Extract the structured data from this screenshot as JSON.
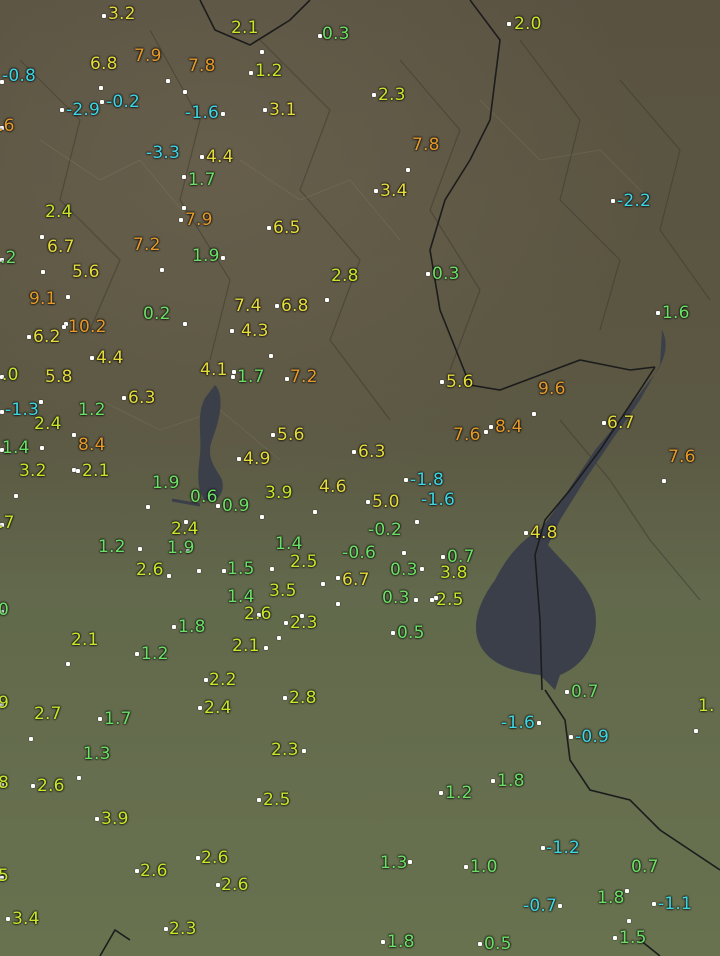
{
  "colors": {
    "cold": "#3dd6e6",
    "cool": "#6be066",
    "mild": "#c9e62a",
    "warm": "#e6dc3c",
    "hot": "#e69a2a",
    "lake": "#3b3f4a",
    "plain": "#66714f",
    "mountain": "#57513f"
  },
  "readings": [
    {
      "id": "s1",
      "value": "3.2",
      "tier": "warm"
    },
    {
      "id": "s2",
      "value": "2.1",
      "tier": "mild"
    },
    {
      "id": "s3",
      "value": "0.3",
      "tier": "cool"
    },
    {
      "id": "s4",
      "value": "2.0",
      "tier": "mild"
    },
    {
      "id": "s5",
      "value": "-0.8",
      "tier": "cold"
    },
    {
      "id": "s6",
      "value": "6.8",
      "tier": "warm"
    },
    {
      "id": "s7",
      "value": "7.9",
      "tier": "hot"
    },
    {
      "id": "s8",
      "value": "7.8",
      "tier": "hot"
    },
    {
      "id": "s9",
      "value": "1.2",
      "tier": "mild"
    },
    {
      "id": "s10",
      "value": ".6",
      "tier": "hot"
    },
    {
      "id": "s11",
      "value": "-2.9",
      "tier": "cold"
    },
    {
      "id": "s12",
      "value": "-0.2",
      "tier": "cold"
    },
    {
      "id": "s13",
      "value": "-1.6",
      "tier": "cold"
    },
    {
      "id": "s14",
      "value": "3.1",
      "tier": "warm"
    },
    {
      "id": "s15",
      "value": "2.3",
      "tier": "mild"
    },
    {
      "id": "s16",
      "value": "-3.3",
      "tier": "cold"
    },
    {
      "id": "s17",
      "value": "4.4",
      "tier": "warm"
    },
    {
      "id": "s18",
      "value": "7.8",
      "tier": "hot"
    },
    {
      "id": "s19",
      "value": "1.7",
      "tier": "cool"
    },
    {
      "id": "s20",
      "value": "3.4",
      "tier": "warm"
    },
    {
      "id": "s21",
      "value": "-2.2",
      "tier": "cold"
    },
    {
      "id": "s22",
      "value": "2.4",
      "tier": "mild"
    },
    {
      "id": "s23",
      "value": "7.9",
      "tier": "hot"
    },
    {
      "id": "s24",
      "value": "6.5",
      "tier": "warm"
    },
    {
      "id": "s25",
      "value": "6.7",
      "tier": "warm"
    },
    {
      "id": "s26",
      "value": "7.2",
      "tier": "hot"
    },
    {
      "id": "s27",
      "value": "1.9",
      "tier": "cool"
    },
    {
      "id": "s28",
      "value": ".2",
      "tier": "cool"
    },
    {
      "id": "s29",
      "value": "5.6",
      "tier": "warm"
    },
    {
      "id": "s30",
      "value": "0.3",
      "tier": "cool"
    },
    {
      "id": "s31",
      "value": "2.8",
      "tier": "mild"
    },
    {
      "id": "s32",
      "value": "9.1",
      "tier": "hot"
    },
    {
      "id": "s33",
      "value": "0.2",
      "tier": "cool"
    },
    {
      "id": "s34",
      "value": "7.4",
      "tier": "warm"
    },
    {
      "id": "s35",
      "value": "6.8",
      "tier": "warm"
    },
    {
      "id": "s36",
      "value": "1.6",
      "tier": "cool"
    },
    {
      "id": "s37",
      "value": "10.2",
      "tier": "hot"
    },
    {
      "id": "s38",
      "value": "6.2",
      "tier": "warm"
    },
    {
      "id": "s39",
      "value": "4.3",
      "tier": "warm"
    },
    {
      "id": "s40",
      "value": "4.4",
      "tier": "warm"
    },
    {
      "id": "s41",
      "value": ".0",
      "tier": "mild"
    },
    {
      "id": "s42",
      "value": "5.8",
      "tier": "warm"
    },
    {
      "id": "s43",
      "value": "4.1",
      "tier": "warm"
    },
    {
      "id": "s44",
      "value": "1.7",
      "tier": "cool"
    },
    {
      "id": "s45",
      "value": "7.2",
      "tier": "hot"
    },
    {
      "id": "s46",
      "value": "5.6",
      "tier": "warm"
    },
    {
      "id": "s47",
      "value": "9.6",
      "tier": "hot"
    },
    {
      "id": "s48",
      "value": "-1.3",
      "tier": "cold"
    },
    {
      "id": "s49",
      "value": "1.2",
      "tier": "cool"
    },
    {
      "id": "s50",
      "value": "6.3",
      "tier": "warm"
    },
    {
      "id": "s51",
      "value": "2.4",
      "tier": "mild"
    },
    {
      "id": "s52",
      "value": "6.7",
      "tier": "warm"
    },
    {
      "id": "s53",
      "value": "8.4",
      "tier": "hot"
    },
    {
      "id": "s54",
      "value": "7.6",
      "tier": "hot"
    },
    {
      "id": "s55",
      "value": "8.4",
      "tier": "hot"
    },
    {
      "id": "s56",
      "value": "5.6",
      "tier": "warm"
    },
    {
      "id": "s57",
      "value": "1.4",
      "tier": "cool"
    },
    {
      "id": "s58",
      "value": "6.3",
      "tier": "warm"
    },
    {
      "id": "s59",
      "value": "4.9",
      "tier": "warm"
    },
    {
      "id": "s60",
      "value": "7.6",
      "tier": "hot"
    },
    {
      "id": "s61",
      "value": "3.2",
      "tier": "mild"
    },
    {
      "id": "s62",
      "value": "2.1",
      "tier": "mild"
    },
    {
      "id": "s63",
      "value": "-1.8",
      "tier": "cold"
    },
    {
      "id": "s64",
      "value": "1.9",
      "tier": "cool"
    },
    {
      "id": "s65",
      "value": "4.6",
      "tier": "warm"
    },
    {
      "id": "s66",
      "value": "-1.6",
      "tier": "cold"
    },
    {
      "id": "s67",
      "value": ".7",
      "tier": "mild"
    },
    {
      "id": "s68",
      "value": "0.6",
      "tier": "cool"
    },
    {
      "id": "s69",
      "value": "0.9",
      "tier": "cool"
    },
    {
      "id": "s70",
      "value": "3.9",
      "tier": "mild"
    },
    {
      "id": "s71",
      "value": "5.0",
      "tier": "warm"
    },
    {
      "id": "s72",
      "value": "4.8",
      "tier": "warm"
    },
    {
      "id": "s73",
      "value": "2.4",
      "tier": "mild"
    },
    {
      "id": "s74",
      "value": "-0.2",
      "tier": "cool"
    },
    {
      "id": "s75",
      "value": "1.2",
      "tier": "cool"
    },
    {
      "id": "s76",
      "value": "1.9",
      "tier": "cool"
    },
    {
      "id": "s77",
      "value": "1.4",
      "tier": "cool"
    },
    {
      "id": "s78",
      "value": "-0.6",
      "tier": "cool"
    },
    {
      "id": "s79",
      "value": "0.7",
      "tier": "cool"
    },
    {
      "id": "s80",
      "value": "2.6",
      "tier": "mild"
    },
    {
      "id": "s81",
      "value": "1.5",
      "tier": "cool"
    },
    {
      "id": "s82",
      "value": "2.5",
      "tier": "mild"
    },
    {
      "id": "s83",
      "value": "6.7",
      "tier": "warm"
    },
    {
      "id": "s84",
      "value": "0.3",
      "tier": "cool"
    },
    {
      "id": "s85",
      "value": "3.8",
      "tier": "mild"
    },
    {
      "id": "s86",
      "value": "0",
      "tier": "cool"
    },
    {
      "id": "s87",
      "value": "1.4",
      "tier": "cool"
    },
    {
      "id": "s88",
      "value": "3.5",
      "tier": "mild"
    },
    {
      "id": "s89",
      "value": "0.3",
      "tier": "cool"
    },
    {
      "id": "s90",
      "value": "2.5",
      "tier": "mild"
    },
    {
      "id": "s91",
      "value": "1.8",
      "tier": "cool"
    },
    {
      "id": "s92",
      "value": "2.6",
      "tier": "mild"
    },
    {
      "id": "s93",
      "value": "2.3",
      "tier": "mild"
    },
    {
      "id": "s94",
      "value": "0.5",
      "tier": "cool"
    },
    {
      "id": "s95",
      "value": "2.1",
      "tier": "mild"
    },
    {
      "id": "s96",
      "value": "1.2",
      "tier": "cool"
    },
    {
      "id": "s97",
      "value": "2.1",
      "tier": "mild"
    },
    {
      "id": "s98",
      "value": "2.2",
      "tier": "mild"
    },
    {
      "id": "s99",
      "value": "0.7",
      "tier": "cool"
    },
    {
      "id": "s100",
      "value": "9",
      "tier": "mild"
    },
    {
      "id": "s101",
      "value": "2.7",
      "tier": "mild"
    },
    {
      "id": "s102",
      "value": "1.7",
      "tier": "cool"
    },
    {
      "id": "s103",
      "value": "2.4",
      "tier": "mild"
    },
    {
      "id": "s104",
      "value": "2.8",
      "tier": "mild"
    },
    {
      "id": "s105",
      "value": "-1.6",
      "tier": "cold"
    },
    {
      "id": "s106",
      "value": "-0.9",
      "tier": "cold"
    },
    {
      "id": "s107",
      "value": "1.",
      "tier": "mild"
    },
    {
      "id": "s108",
      "value": "1.3",
      "tier": "cool"
    },
    {
      "id": "s109",
      "value": "2.3",
      "tier": "mild"
    },
    {
      "id": "s110",
      "value": "8",
      "tier": "mild"
    },
    {
      "id": "s111",
      "value": "2.6",
      "tier": "mild"
    },
    {
      "id": "s112",
      "value": "1.8",
      "tier": "cool"
    },
    {
      "id": "s113",
      "value": "1.2",
      "tier": "cool"
    },
    {
      "id": "s114",
      "value": "2.5",
      "tier": "mild"
    },
    {
      "id": "s115",
      "value": "3.9",
      "tier": "mild"
    },
    {
      "id": "s116",
      "value": "-1.2",
      "tier": "cold"
    },
    {
      "id": "s117",
      "value": "2.6",
      "tier": "mild"
    },
    {
      "id": "s118",
      "value": "1.3",
      "tier": "cool"
    },
    {
      "id": "s119",
      "value": "1.0",
      "tier": "cool"
    },
    {
      "id": "s120",
      "value": "5",
      "tier": "mild"
    },
    {
      "id": "s121",
      "value": "2.6",
      "tier": "mild"
    },
    {
      "id": "s122",
      "value": "2.6",
      "tier": "mild"
    },
    {
      "id": "s123",
      "value": "0.7",
      "tier": "cool"
    },
    {
      "id": "s124",
      "value": "1.8",
      "tier": "cool"
    },
    {
      "id": "s125",
      "value": "-0.7",
      "tier": "cold"
    },
    {
      "id": "s126",
      "value": "-1.1",
      "tier": "cold"
    },
    {
      "id": "s127",
      "value": "3.4",
      "tier": "mild"
    },
    {
      "id": "s128",
      "value": "2.3",
      "tier": "mild"
    },
    {
      "id": "s129",
      "value": "1.8",
      "tier": "cool"
    },
    {
      "id": "s130",
      "value": "0.5",
      "tier": "cool"
    },
    {
      "id": "s131",
      "value": "1.5",
      "tier": "cool"
    }
  ]
}
